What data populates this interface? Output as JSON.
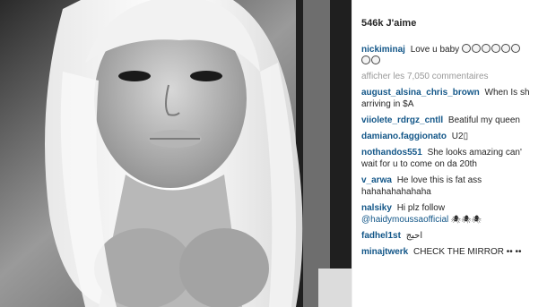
{
  "post": {
    "likes": "546k J'aime",
    "caption": {
      "user": "nickiminaj",
      "text": "Love u baby",
      "emoji_count_line1": 6,
      "emoji_count_line2": 2
    },
    "view_all": "afficher les 7,050 commentaires"
  },
  "comments": [
    {
      "user": "august_alsina_chris_brown",
      "text": "When Is sh",
      "text2": "arriving in $A"
    },
    {
      "user": "viiolete_rdrgz_cntll",
      "text": "Beatiful my queen"
    },
    {
      "user": "damiano.faggionato",
      "text": "U2▯"
    },
    {
      "user": "nothandos551",
      "text": "She looks amazing can'",
      "text2": "wait for u to come on da 20th"
    },
    {
      "user": "v_arwa",
      "text": "He love this is fat ass",
      "text2": "hahahahahahaha"
    },
    {
      "user": "nalsiky",
      "text": "Hi plz follow",
      "mention": "@haidymoussaofficial",
      "mention_suffix": "🕷🕷🕷"
    },
    {
      "user": "fadhel1st",
      "text": "احبج"
    },
    {
      "user": "minajtwerk",
      "text": "CHECK THE MIRROR",
      "text_suffix": "•• ••"
    }
  ],
  "colors": {
    "username": "#125688",
    "muted": "#999999",
    "text": "#262626"
  }
}
